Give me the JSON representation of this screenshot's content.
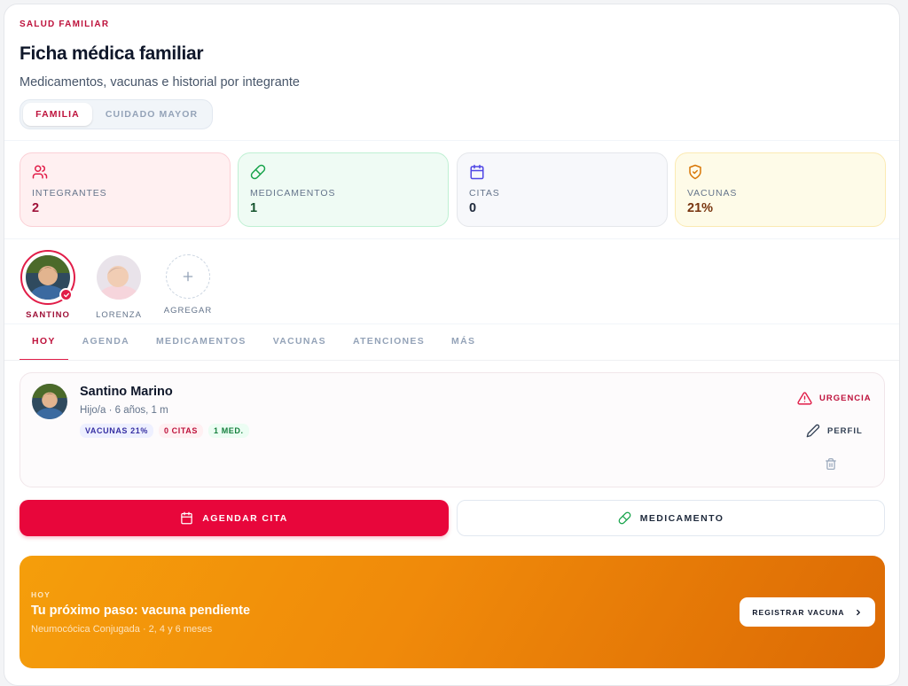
{
  "header": {
    "eyebrow": "SALUD FAMILIAR",
    "title": "Ficha médica familiar",
    "subtitle": "Medicamentos, vacunas e historial por integrante"
  },
  "segment": {
    "options": [
      {
        "label": "FAMILIA",
        "active": true
      },
      {
        "label": "CUIDADO MAYOR",
        "active": false
      }
    ]
  },
  "stats": [
    {
      "icon": "users-icon",
      "label": "INTEGRANTES",
      "value": "2",
      "bg": "#fff0f1",
      "border": "#fbd0d6",
      "icon_color": "#e11d48",
      "value_color": "#9f1239"
    },
    {
      "icon": "pill-icon",
      "label": "MEDICAMENTOS",
      "value": "1",
      "bg": "#effbf4",
      "border": "#bff0d3",
      "icon_color": "#16a34a",
      "value_color": "#14532d"
    },
    {
      "icon": "calendar-icon",
      "label": "CITAS",
      "value": "0",
      "bg": "#f7f8fb",
      "border": "#e5e7eb",
      "icon_color": "#4f46e5",
      "value_color": "#1e293b"
    },
    {
      "icon": "shield-check-icon",
      "label": "VACUNAS",
      "value": "21%",
      "bg": "#fefbe8",
      "border": "#fbeab3",
      "icon_color": "#d97706",
      "value_color": "#78350f"
    }
  ],
  "profiles": [
    {
      "name": "SANTINO",
      "selected": true
    },
    {
      "name": "LORENZA",
      "selected": false
    },
    {
      "name": "AGREGAR",
      "add": true
    }
  ],
  "tabs": [
    {
      "label": "HOY",
      "active": true
    },
    {
      "label": "AGENDA"
    },
    {
      "label": "MEDICAMENTOS"
    },
    {
      "label": "VACUNAS"
    },
    {
      "label": "ATENCIONES"
    },
    {
      "label": "MÁS"
    }
  ],
  "member": {
    "name": "Santino Marino",
    "meta": "Hijo/a · 6 años, 1 m",
    "chips": [
      {
        "label": "VACUNAS 21%",
        "bg": "#eef0ff",
        "color": "#3730a3"
      },
      {
        "label": "0 CITAS",
        "bg": "#fff0f2",
        "color": "#be123c"
      },
      {
        "label": "1 MED.",
        "bg": "#ecfdf3",
        "color": "#15803d"
      }
    ],
    "actions": {
      "urgencia": "URGENCIA",
      "perfil": "PERFIL"
    }
  },
  "buttons": {
    "agendar": "AGENDAR CITA",
    "medicamento": "MEDICAMENTO"
  },
  "banner": {
    "eyebrow": "HOY",
    "title": "Tu próximo paso: vacuna pendiente",
    "subtitle": "Neumocócica Conjugada · 2, 4 y 6 meses",
    "button": "REGISTRAR VACUNA"
  }
}
